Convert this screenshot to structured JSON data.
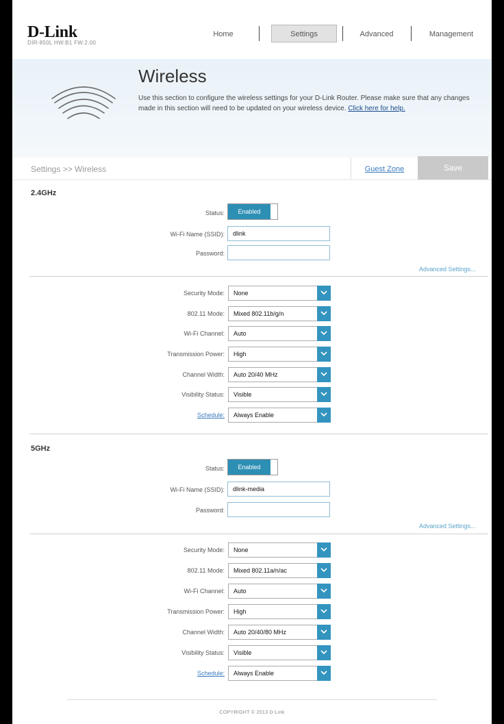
{
  "header": {
    "logo": "D-Link",
    "model": "DIR-850L   HW:B1   FW:2.00",
    "nav": [
      "Home",
      "Settings",
      "Advanced",
      "Management"
    ]
  },
  "banner": {
    "title": "Wireless",
    "desc": "Use this section to configure the wireless settings for your D-Link Router. Please make sure that any changes made in this section will need to be updated on your wireless device.",
    "help_link": "Click here for help."
  },
  "breadcrumb": "Settings >> Wireless",
  "guest_zone": "Guest Zone",
  "save": "Save",
  "band24": {
    "title": "2.4GHz",
    "status_label": "Status:",
    "status_value": "Enabled",
    "ssid_label": "Wi-Fi Name (SSID):",
    "ssid_value": "dlink",
    "password_label": "Password:",
    "password_value": "",
    "advanced": "Advanced Settings...",
    "security_label": "Security Mode:",
    "security_value": "None",
    "mode_label": "802.11 Mode:",
    "mode_value": "Mixed 802.11b/g/n",
    "channel_label": "Wi-Fi Channel:",
    "channel_value": "Auto",
    "power_label": "Transmission Power:",
    "power_value": "High",
    "width_label": "Channel Width:",
    "width_value": "Auto 20/40 MHz",
    "visibility_label": "Visibility Status:",
    "visibility_value": "Visible",
    "schedule_label": "Schedule:",
    "schedule_value": "Always Enable"
  },
  "band5": {
    "title": "5GHz",
    "status_label": "Status:",
    "status_value": "Enabled",
    "ssid_label": "Wi-Fi Name (SSID):",
    "ssid_value": "dlink-media",
    "password_label": "Password:",
    "password_value": "",
    "advanced": "Advanced Settings...",
    "security_label": "Security Mode:",
    "security_value": "None",
    "mode_label": "802.11 Mode:",
    "mode_value": "Mixed 802.11a/n/ac",
    "channel_label": "Wi-Fi Channel:",
    "channel_value": "Auto",
    "power_label": "Transmission Power:",
    "power_value": "High",
    "width_label": "Channel Width:",
    "width_value": "Auto 20/40/80 MHz",
    "visibility_label": "Visibility Status:",
    "visibility_value": "Visible",
    "schedule_label": "Schedule:",
    "schedule_value": "Always Enable"
  },
  "footer": "COPYRIGHT © 2013 D-Link"
}
